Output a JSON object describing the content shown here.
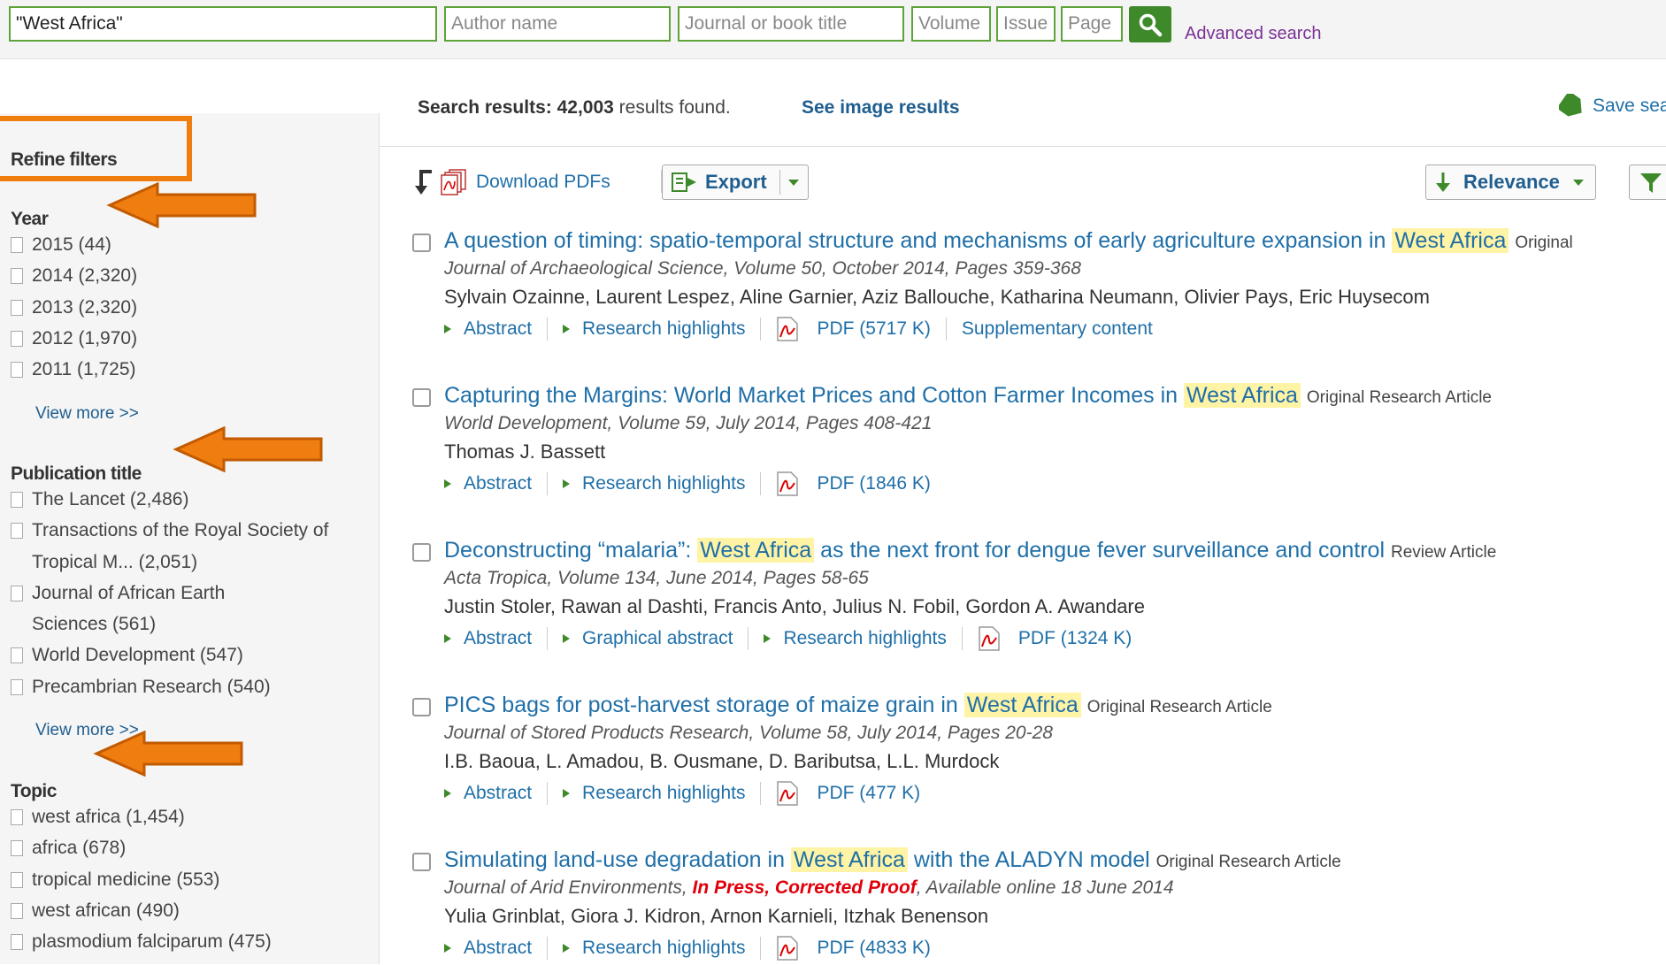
{
  "search": {
    "terms_value": "\"West Africa\"",
    "author_placeholder": "Author name",
    "journal_placeholder": "Journal or book title",
    "volume_placeholder": "Volume",
    "issue_placeholder": "Issue",
    "page_placeholder": "Page",
    "advanced_label": "Advanced search"
  },
  "summary": {
    "label": "Search results:",
    "count": "42,003",
    "suffix": "results found.",
    "image_results": "See image results",
    "save_search": "Save sea"
  },
  "sidebar": {
    "title": "Refine filters",
    "year": {
      "heading": "Year",
      "items": [
        "2015 (44)",
        "2014 (2,320)",
        "2013 (2,320)",
        "2012 (1,970)",
        "2011 (1,725)"
      ],
      "view_more": "View more >>"
    },
    "publication": {
      "heading": "Publication title",
      "items": [
        {
          "l1": "The Lancet  (2,486)",
          "l2": ""
        },
        {
          "l1": "Transactions of the Royal Society of",
          "l2": "Tropical M...  (2,051)"
        },
        {
          "l1": "Journal of African Earth",
          "l2": "Sciences  (561)"
        },
        {
          "l1": "World Development  (547)",
          "l2": ""
        },
        {
          "l1": "Precambrian Research  (540)",
          "l2": ""
        }
      ],
      "view_more": "View more >>"
    },
    "topic": {
      "heading": "Topic",
      "items": [
        "west africa  (1,454)",
        "africa  (678)",
        "tropical medicine  (553)",
        "west african  (490)",
        "plasmodium falciparum  (475)"
      ]
    }
  },
  "toolbar": {
    "download_pdfs": "Download PDFs",
    "export": "Export",
    "sort": "Relevance"
  },
  "results": [
    {
      "t_pre": "A question of timing: spatio-temporal structure and mechanisms of early agriculture expansion in",
      "t_hl": "West Africa",
      "t_post": "",
      "type": "Original",
      "source": "Journal of Archaeological Science, Volume 50, October 2014, Pages 359-368",
      "authors": "Sylvain Ozainne, Laurent Lespez, Aline Garnier, Aziz Ballouche, Katharina Neumann, Olivier Pays, Eric Huysecom",
      "links": [
        "Abstract",
        "Research highlights"
      ],
      "pdf": "PDF (5717 K)",
      "extra": "Supplementary content"
    },
    {
      "t_pre": "Capturing the Margins: World Market Prices and Cotton Farmer Incomes in",
      "t_hl": "West Africa",
      "t_post": "",
      "type": "Original Research Article",
      "source": "World Development, Volume 59, July 2014, Pages 408-421",
      "authors": "Thomas J. Bassett",
      "links": [
        "Abstract",
        "Research highlights"
      ],
      "pdf": "PDF (1846 K)"
    },
    {
      "t_pre": "Deconstructing “malaria”:",
      "t_hl": "West Africa",
      "t_post": "as the next front for dengue fever surveillance and control",
      "type": "Review Article",
      "source": "Acta Tropica, Volume 134, June 2014, Pages 58-65",
      "authors": "Justin Stoler, Rawan al Dashti, Francis Anto, Julius N. Fobil, Gordon A. Awandare",
      "links": [
        "Abstract",
        "Graphical abstract",
        "Research highlights"
      ],
      "pdf": "PDF (1324 K)"
    },
    {
      "t_pre": "PICS bags for post-harvest storage of maize grain in",
      "t_hl": "West Africa",
      "t_post": "",
      "type": "Original Research Article",
      "source": "Journal of Stored Products Research, Volume 58, July 2014, Pages 20-28",
      "authors": "I.B. Baoua, L. Amadou, B. Ousmane, D. Baributsa, L.L. Murdock",
      "links": [
        "Abstract",
        "Research highlights"
      ],
      "pdf": "PDF (477 K)"
    },
    {
      "t_pre": "Simulating land-use degradation in",
      "t_hl": "West Africa",
      "t_post": "with the ALADYN model",
      "type": "Original Research Article",
      "source_pre": "Journal of Arid Environments,",
      "source_red": "In Press, Corrected Proof",
      "source_post": ", Available online 18 June 2014",
      "authors": "Yulia Grinblat, Giora J. Kidron, Arnon Karnieli, Itzhak Benenson",
      "links": [
        "Abstract",
        "Research highlights"
      ],
      "pdf": "PDF (4833 K)"
    }
  ],
  "colors": {
    "accent_green": "#3e8a2a",
    "link_blue": "#1f6fa8",
    "highlight": "#fff3a6",
    "annotation_orange": "#f07d0f"
  }
}
